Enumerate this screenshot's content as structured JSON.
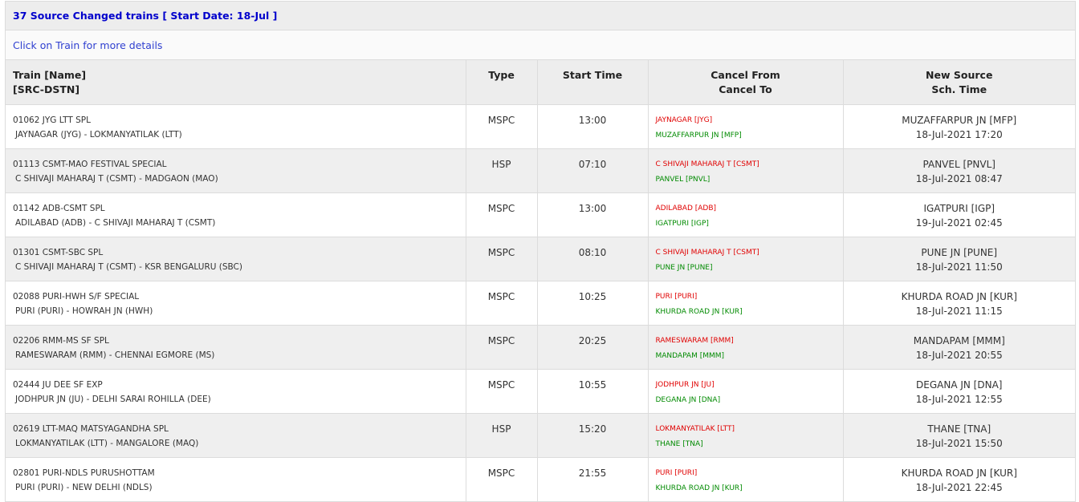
{
  "header": {
    "title": "37 Source Changed trains [ Start Date: 18-Jul ]",
    "hint": "Click on Train for more details"
  },
  "columns": {
    "train_line1": "Train [Name]",
    "train_line2": "[SRC-DSTN]",
    "type": "Type",
    "start_time": "Start Time",
    "cancel_line1": "Cancel From",
    "cancel_line2": "Cancel To",
    "newsrc_line1": "New Source",
    "newsrc_line2": "Sch. Time"
  },
  "colors": {
    "title_link": "#0000cc",
    "cancel_from": "#e00000",
    "cancel_to": "#008a00"
  },
  "rows": [
    {
      "train": "01062 JYG LTT SPL",
      "route": "JAYNAGAR (JYG) - LOKMANYATILAK (LTT)",
      "type": "MSPC",
      "start": "13:00",
      "from": "JAYNAGAR [JYG]",
      "to": "MUZAFFARPUR JN [MFP]",
      "new_source": "MUZAFFARPUR JN [MFP]",
      "sch_time": "18-Jul-2021 17:20"
    },
    {
      "train": "01113 CSMT-MAO FESTIVAL SPECIAL",
      "route": "C SHIVAJI MAHARAJ T (CSMT) - MADGAON (MAO)",
      "type": "HSP",
      "start": "07:10",
      "from": "C SHIVAJI MAHARAJ T [CSMT]",
      "to": "PANVEL [PNVL]",
      "new_source": "PANVEL [PNVL]",
      "sch_time": "18-Jul-2021 08:47"
    },
    {
      "train": "01142 ADB-CSMT SPL",
      "route": "ADILABAD (ADB) - C SHIVAJI MAHARAJ T (CSMT)",
      "type": "MSPC",
      "start": "13:00",
      "from": "ADILABAD [ADB]",
      "to": "IGATPURI [IGP]",
      "new_source": "IGATPURI [IGP]",
      "sch_time": "19-Jul-2021 02:45"
    },
    {
      "train": "01301 CSMT-SBC SPL",
      "route": "C SHIVAJI MAHARAJ T (CSMT) - KSR BENGALURU (SBC)",
      "type": "MSPC",
      "start": "08:10",
      "from": "C SHIVAJI MAHARAJ T [CSMT]",
      "to": "PUNE JN [PUNE]",
      "new_source": "PUNE JN [PUNE]",
      "sch_time": "18-Jul-2021 11:50"
    },
    {
      "train": "02088 PURI-HWH S/F SPECIAL",
      "route": "PURI (PURI) - HOWRAH JN (HWH)",
      "type": "MSPC",
      "start": "10:25",
      "from": "PURI [PURI]",
      "to": "KHURDA ROAD JN [KUR]",
      "new_source": "KHURDA ROAD JN [KUR]",
      "sch_time": "18-Jul-2021 11:15"
    },
    {
      "train": "02206 RMM-MS SF SPL",
      "route": "RAMESWARAM (RMM) - CHENNAI EGMORE (MS)",
      "type": "MSPC",
      "start": "20:25",
      "from": "RAMESWARAM [RMM]",
      "to": "MANDAPAM [MMM]",
      "new_source": "MANDAPAM [MMM]",
      "sch_time": "18-Jul-2021 20:55"
    },
    {
      "train": "02444 JU DEE SF EXP",
      "route": "JODHPUR JN (JU) - DELHI SARAI ROHILLA (DEE)",
      "type": "MSPC",
      "start": "10:55",
      "from": "JODHPUR JN [JU]",
      "to": "DEGANA JN [DNA]",
      "new_source": "DEGANA JN [DNA]",
      "sch_time": "18-Jul-2021 12:55"
    },
    {
      "train": "02619 LTT-MAQ MATSYAGANDHA SPL",
      "route": "LOKMANYATILAK (LTT) - MANGALORE (MAQ)",
      "type": "HSP",
      "start": "15:20",
      "from": "LOKMANYATILAK [LTT]",
      "to": "THANE [TNA]",
      "new_source": "THANE [TNA]",
      "sch_time": "18-Jul-2021 15:50"
    },
    {
      "train": "02801 PURI-NDLS PURUSHOTTAM",
      "route": "PURI (PURI) - NEW DELHI (NDLS)",
      "type": "MSPC",
      "start": "21:55",
      "from": "PURI [PURI]",
      "to": "KHURDA ROAD JN [KUR]",
      "new_source": "KHURDA ROAD JN [KUR]",
      "sch_time": "18-Jul-2021 22:45"
    }
  ]
}
